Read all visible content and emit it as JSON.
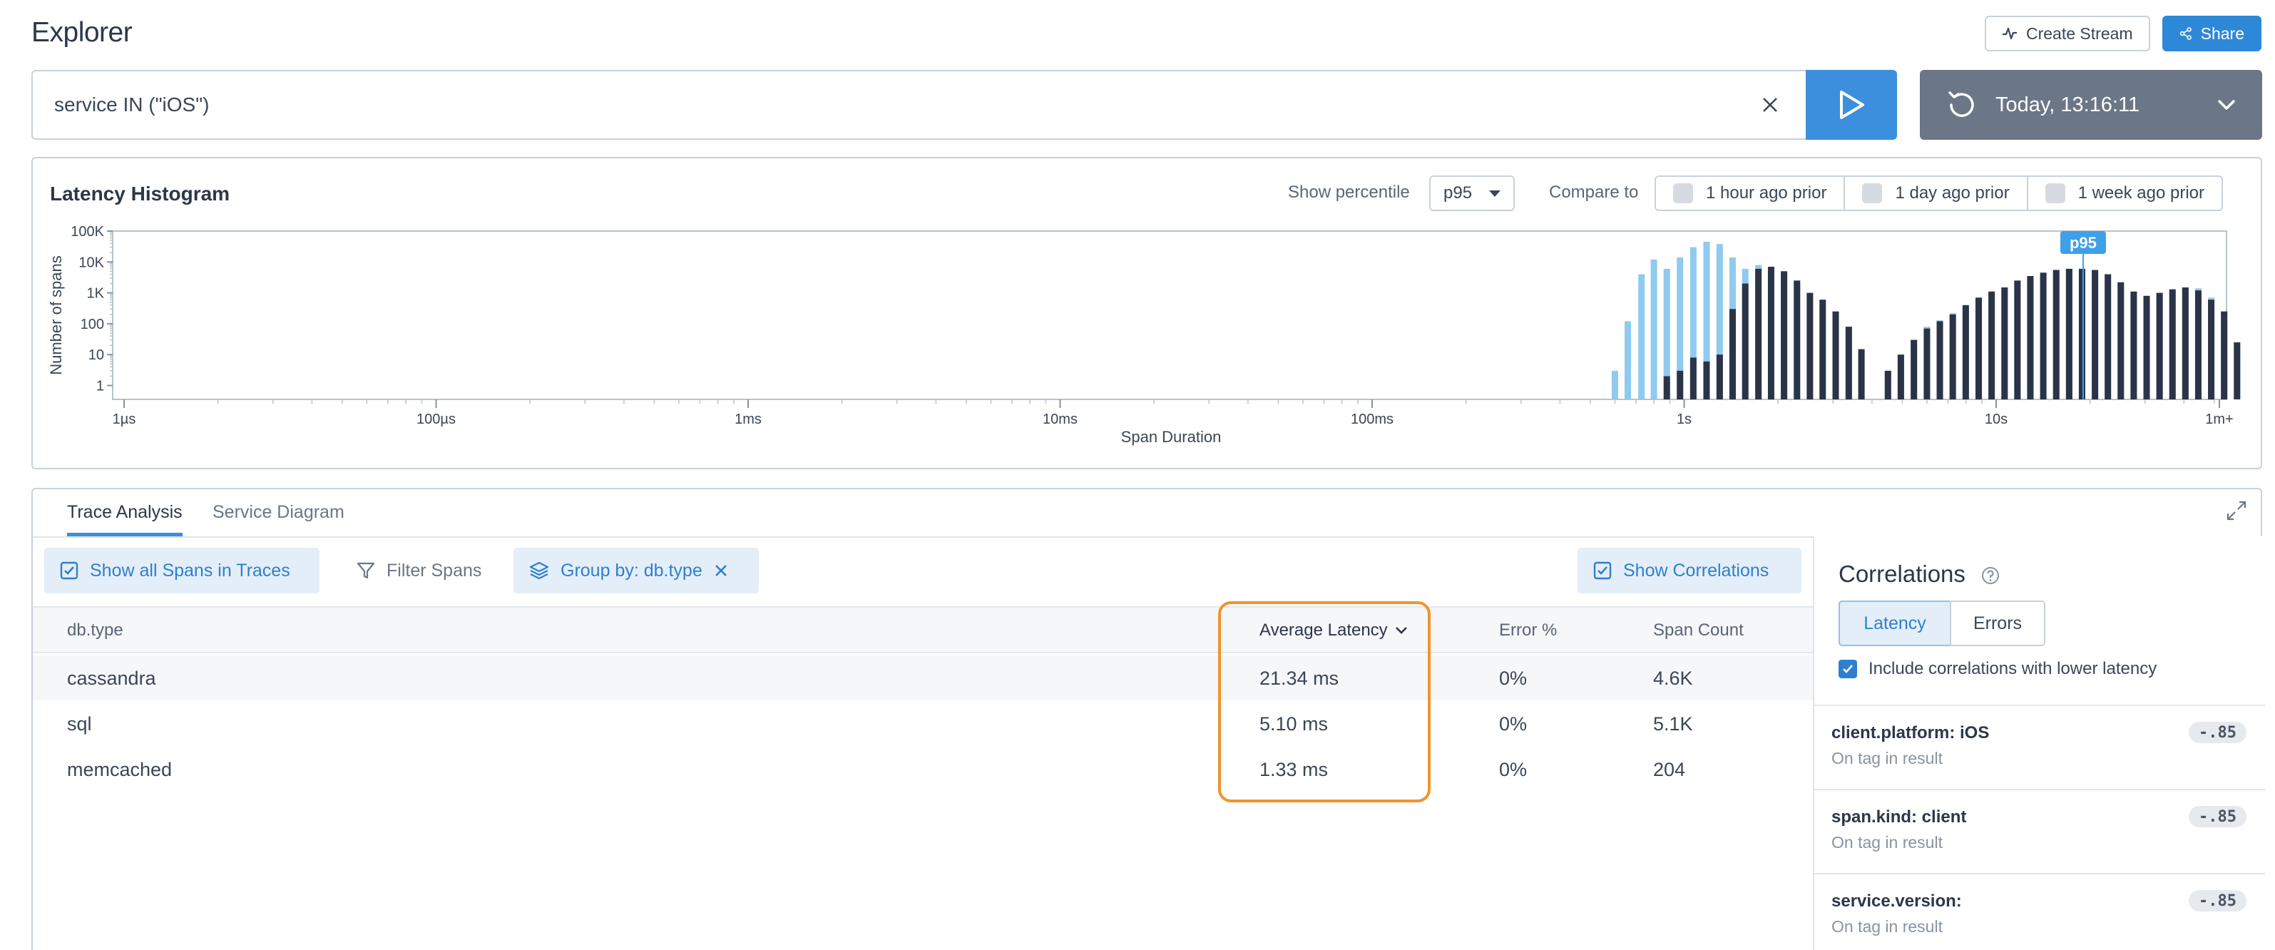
{
  "header": {
    "title": "Explorer",
    "create_stream_label": "Create Stream",
    "share_label": "Share"
  },
  "query": {
    "text": "service IN (\"iOS\")",
    "time_label": "Today, 13:16:11"
  },
  "histogram": {
    "title": "Latency Histogram",
    "percentile_label": "Show percentile",
    "percentile_value": "p95",
    "compare_label": "Compare to",
    "compare_options": [
      "1 hour ago prior",
      "1 day ago prior",
      "1 week ago prior"
    ],
    "marker_label": "p95",
    "colors": {
      "light": "#8fcaf0",
      "dark": "#2b3447",
      "marker": "#3ea0e8"
    }
  },
  "chart_data": {
    "type": "bar",
    "scale": "log",
    "xlabel": "Span Duration",
    "ylabel": "Number of spans",
    "x_ticks": [
      "1µs",
      "100µs",
      "1ms",
      "10ms",
      "100ms",
      "1s",
      "10s",
      "1m+"
    ],
    "y_ticks": [
      "100K",
      "10K",
      "1K",
      "100",
      "10",
      "1"
    ],
    "ylim": [
      1,
      100000
    ],
    "marker_ms": 1900,
    "series": [
      {
        "name": "",
        "bars": [
          {
            "ms": 60,
            "light": 3,
            "dark": 0
          },
          {
            "ms": 66,
            "light": 120,
            "dark": 0
          },
          {
            "ms": 73,
            "light": 4000,
            "dark": 0
          },
          {
            "ms": 80,
            "light": 12000,
            "dark": 0
          },
          {
            "ms": 88,
            "light": 6000,
            "dark": 2
          },
          {
            "ms": 97,
            "light": 14000,
            "dark": 3
          },
          {
            "ms": 107,
            "light": 30000,
            "dark": 8
          },
          {
            "ms": 118,
            "light": 45000,
            "dark": 6
          },
          {
            "ms": 130,
            "light": 38000,
            "dark": 10
          },
          {
            "ms": 143,
            "light": 14000,
            "dark": 300
          },
          {
            "ms": 157,
            "light": 6000,
            "dark": 2000
          },
          {
            "ms": 173,
            "light": 8000,
            "dark": 6000
          },
          {
            "ms": 190,
            "light": 7000,
            "dark": 7000
          },
          {
            "ms": 209,
            "light": 5000,
            "dark": 5000
          },
          {
            "ms": 230,
            "light": 2500,
            "dark": 2500
          },
          {
            "ms": 253,
            "light": 1000,
            "dark": 1000
          },
          {
            "ms": 278,
            "light": 600,
            "dark": 600
          },
          {
            "ms": 306,
            "light": 250,
            "dark": 250
          },
          {
            "ms": 337,
            "light": 80,
            "dark": 80
          },
          {
            "ms": 370,
            "light": 15,
            "dark": 15
          },
          {
            "ms": 450,
            "light": 3,
            "dark": 3
          },
          {
            "ms": 495,
            "light": 10,
            "dark": 10
          },
          {
            "ms": 545,
            "light": 30,
            "dark": 30
          },
          {
            "ms": 600,
            "light": 80,
            "dark": 70
          },
          {
            "ms": 660,
            "light": 130,
            "dark": 120
          },
          {
            "ms": 726,
            "light": 220,
            "dark": 200
          },
          {
            "ms": 799,
            "light": 400,
            "dark": 400
          },
          {
            "ms": 879,
            "light": 700,
            "dark": 700
          },
          {
            "ms": 967,
            "light": 1100,
            "dark": 1100
          },
          {
            "ms": 1064,
            "light": 1500,
            "dark": 1500
          },
          {
            "ms": 1170,
            "light": 2500,
            "dark": 2500
          },
          {
            "ms": 1287,
            "light": 3500,
            "dark": 3500
          },
          {
            "ms": 1416,
            "light": 4500,
            "dark": 4500
          },
          {
            "ms": 1558,
            "light": 5500,
            "dark": 5500
          },
          {
            "ms": 1714,
            "light": 6000,
            "dark": 6000
          },
          {
            "ms": 1885,
            "light": 6000,
            "dark": 6000
          },
          {
            "ms": 2074,
            "light": 5500,
            "dark": 5500
          },
          {
            "ms": 2281,
            "light": 4000,
            "dark": 4000
          },
          {
            "ms": 2509,
            "light": 2200,
            "dark": 2200
          },
          {
            "ms": 2760,
            "light": 1100,
            "dark": 1100
          },
          {
            "ms": 3036,
            "light": 800,
            "dark": 800
          },
          {
            "ms": 3340,
            "light": 1000,
            "dark": 1000
          },
          {
            "ms": 3674,
            "light": 1300,
            "dark": 1300
          },
          {
            "ms": 4041,
            "light": 1500,
            "dark": 1500
          },
          {
            "ms": 4445,
            "light": 1400,
            "dark": 1200
          },
          {
            "ms": 4890,
            "light": 700,
            "dark": 600
          },
          {
            "ms": 5379,
            "light": 250,
            "dark": 250
          },
          {
            "ms": 5917,
            "light": 25,
            "dark": 25
          }
        ]
      }
    ]
  },
  "analysis": {
    "tabs": [
      "Trace Analysis",
      "Service Diagram"
    ],
    "show_spans_label": "Show all Spans in Traces",
    "filter_label": "Filter Spans",
    "group_label": "Group by: db.type",
    "show_corr_label": "Show Correlations",
    "columns": {
      "name": "db.type",
      "latency": "Average Latency",
      "error": "Error %",
      "count": "Span Count"
    },
    "rows": [
      {
        "name": "cassandra",
        "latency": "21.34 ms",
        "error": "0%",
        "count": "4.6K"
      },
      {
        "name": "sql",
        "latency": "5.10 ms",
        "error": "0%",
        "count": "5.1K"
      },
      {
        "name": "memcached",
        "latency": "1.33 ms",
        "error": "0%",
        "count": "204"
      }
    ]
  },
  "correlations": {
    "title": "Correlations",
    "modes": [
      "Latency",
      "Errors"
    ],
    "lower_label": "Include correlations with lower latency",
    "items": [
      {
        "name": "client.platform: iOS",
        "sub": "On tag in result",
        "score": "-.85"
      },
      {
        "name": "span.kind: client",
        "sub": "On tag in result",
        "score": "-.85"
      },
      {
        "name": "service.version:",
        "sub": "On tag in result",
        "score": "-.85"
      }
    ]
  }
}
